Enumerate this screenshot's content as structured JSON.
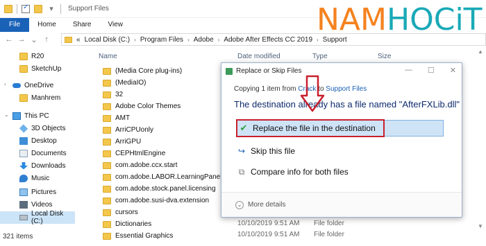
{
  "window": {
    "title": "Support Files"
  },
  "brand": {
    "part1": "NAM",
    "part2": "HOC",
    "part3": "iT"
  },
  "ribbon": {
    "tabs": [
      "File",
      "Home",
      "Share",
      "View"
    ]
  },
  "address": {
    "prefix": "«",
    "crumbs": [
      "Local Disk (C:)",
      "Program Files",
      "Adobe",
      "Adobe After Effects CC 2019",
      "Support"
    ]
  },
  "nav": {
    "items": [
      {
        "label": "R20",
        "icon": "folder"
      },
      {
        "label": "SketchUp",
        "icon": "folder"
      },
      {
        "label": "OneDrive",
        "icon": "cloud"
      },
      {
        "label": "Manhrem",
        "icon": "folder"
      },
      {
        "label": "This PC",
        "icon": "pc"
      },
      {
        "label": "3D Objects",
        "icon": "cube"
      },
      {
        "label": "Desktop",
        "icon": "desktop"
      },
      {
        "label": "Documents",
        "icon": "document"
      },
      {
        "label": "Downloads",
        "icon": "download"
      },
      {
        "label": "Music",
        "icon": "music"
      },
      {
        "label": "Pictures",
        "icon": "pictures"
      },
      {
        "label": "Videos",
        "icon": "videos"
      },
      {
        "label": "Local Disk (C:)",
        "icon": "drive"
      }
    ]
  },
  "columns": {
    "name": "Name",
    "date": "Date modified",
    "type": "Type",
    "size": "Size"
  },
  "files": [
    "(Media Core plug-ins)",
    "(MediaIO)",
    "32",
    "Adobe Color Themes",
    "AMT",
    "ArriCPUonly",
    "ArriGPU",
    "CEPHtmlEngine",
    "com.adobe.ccx.start",
    "com.adobe.LABOR.LearningPanel",
    "com.adobe.stock.panel.licensing",
    "com.adobe.susi-dva.extension",
    "cursors",
    "Dictionaries",
    "Essential Graphics"
  ],
  "visible_details": [
    {
      "date": "10/10/2019 9:51 AM",
      "type": "File folder"
    },
    {
      "date": "10/10/2019 9:51 AM",
      "type": "File folder"
    }
  ],
  "status": {
    "items": "321 items"
  },
  "dialog": {
    "title": "Replace or Skip Files",
    "copying_prefix": "Copying 1 item from ",
    "from": "Crack",
    "to_word": " to ",
    "to": "Support Files",
    "message": "The destination already has a file named \"AfterFXLib.dll\"",
    "options": {
      "replace": "Replace the file in the destination",
      "skip": "Skip this file",
      "compare": "Compare info for both files"
    },
    "more": "More details"
  },
  "colors": {
    "accent": "#1a62b8",
    "highlight": "#c8202e",
    "selection": "#cfe3f7"
  }
}
